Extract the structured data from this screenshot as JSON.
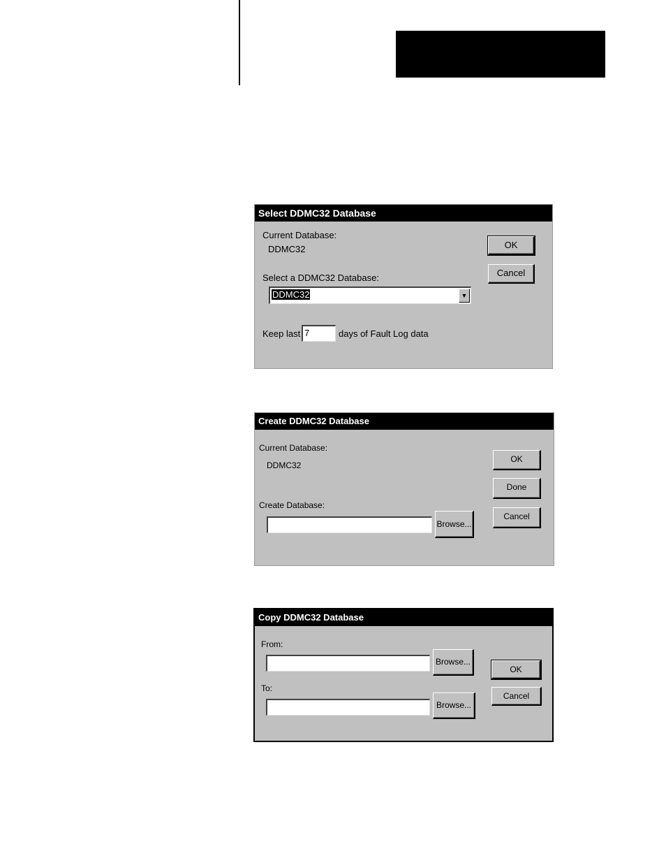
{
  "select_dialog": {
    "title": "Select DDMC32 Database",
    "current_label": "Current Database:",
    "current_value": "DDMC32",
    "select_label": "Select a DDMC32 Database:",
    "selected_value": "DDMC32",
    "keep_prefix": "Keep last",
    "keep_days": "7",
    "keep_suffix": "days of Fault Log data",
    "ok_label": "OK",
    "cancel_label": "Cancel"
  },
  "create_dialog": {
    "title": "Create DDMC32 Database",
    "current_label": "Current Database:",
    "current_value": "DDMC32",
    "create_label": "Create Database:",
    "create_value": "",
    "browse_label": "Browse...",
    "ok_label": "OK",
    "done_label": "Done",
    "cancel_label": "Cancel"
  },
  "copy_dialog": {
    "title": "Copy DDMC32 Database",
    "from_label": "From:",
    "from_value": "",
    "to_label": "To:",
    "to_value": "",
    "browse_from_label": "Browse...",
    "browse_to_label": "Browse...",
    "ok_label": "OK",
    "cancel_label": "Cancel"
  }
}
